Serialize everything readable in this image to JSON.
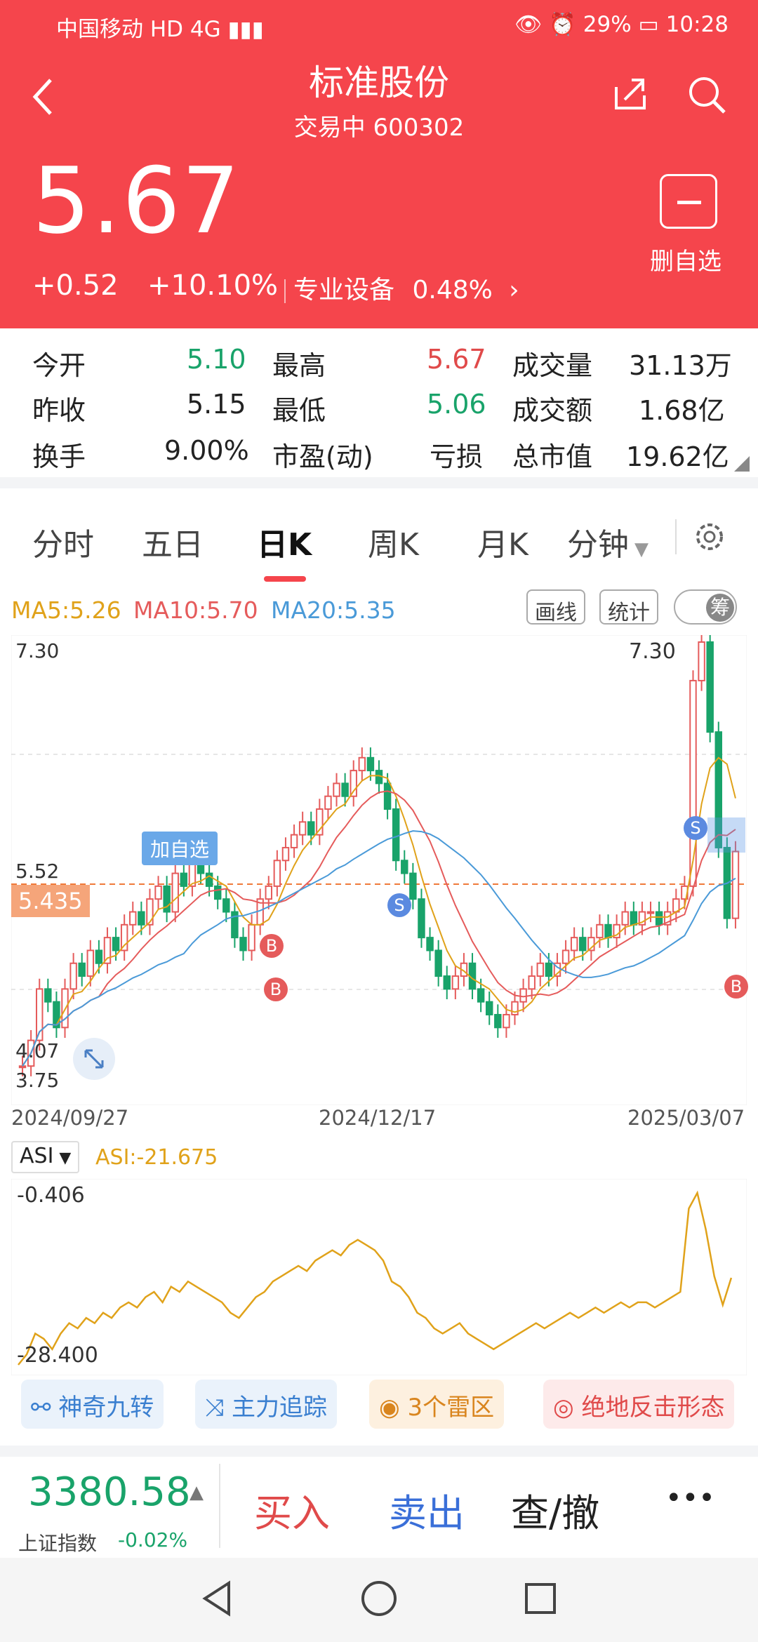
{
  "status_bar": {
    "left": "中国移动 HD 4G ▮▮▮",
    "right": "👁 ⏰ 29% ▭ 10:28"
  },
  "header": {
    "back_icon": "back-chevron-icon",
    "title": "标准股份",
    "subtitle": "交易中 600302",
    "share_icon": "share-icon",
    "search_icon": "search-icon"
  },
  "quote": {
    "price": "5.67",
    "change": "+0.52",
    "change_pct": "+10.10%",
    "sector": "专业设备",
    "sector_pct": "0.48%",
    "sector_arrow": "›",
    "remove_fav_label": "删自选"
  },
  "stats": {
    "row1": [
      {
        "label": "今开",
        "value": "5.10"
      },
      {
        "label": "最高",
        "value": "5.67"
      },
      {
        "label": "成交量",
        "value": "31.13万"
      }
    ],
    "row2": [
      {
        "label": "昨收",
        "value": "5.15"
      },
      {
        "label": "最低",
        "value": "5.06"
      },
      {
        "label": "成交额",
        "value": "1.68亿"
      }
    ],
    "row3": [
      {
        "label": "换手",
        "value": "9.00%"
      },
      {
        "label": "市盈(动)",
        "value": "亏损"
      },
      {
        "label": "总市值",
        "value": "19.62亿"
      }
    ]
  },
  "tabs": [
    "分时",
    "五日",
    "日K",
    "周K",
    "月K",
    "分钟"
  ],
  "tab_active": "日K",
  "ma": {
    "ma5": "MA5:5.26",
    "ma10": "MA10:5.70",
    "ma20": "MA20:5.35"
  },
  "chart_buttons": {
    "draw": "画线",
    "stats": "统计",
    "chip": "筹"
  },
  "chart_labels": {
    "y_high": "7.30",
    "y_low": "3.75",
    "peak": "7.30",
    "mid": "5.52",
    "cross": "5.435",
    "low_mark": "4.07",
    "add_fav_tag": "加自选"
  },
  "markers": {
    "buy": "B",
    "sell": "S"
  },
  "dates": [
    "2024/09/27",
    "2024/12/17",
    "2025/03/07"
  ],
  "asi": {
    "selector": "ASI",
    "value": "ASI:-21.675",
    "top": "-0.406",
    "bottom": "-28.400"
  },
  "features": [
    "神奇九转",
    "主力追踪",
    "3个雷区",
    "绝地反击形态"
  ],
  "bottom": {
    "index_value": "3380.58",
    "index_name": "上证指数",
    "index_pct": "-0.02%",
    "buy": "买入",
    "sell": "卖出",
    "query": "查/撤",
    "more": "•••"
  },
  "colors": {
    "red": "#f5454c",
    "green": "#19a36a",
    "ma5": "#e0a21a",
    "ma10": "#e55b5b",
    "ma20": "#4a9ad8"
  },
  "chart_data": {
    "type": "candlestick",
    "x_labels": [
      "2024/09/27",
      "2024/12/17",
      "2025/03/07"
    ],
    "ylim": [
      3.75,
      7.3
    ],
    "closes": [
      4.0,
      4.2,
      4.6,
      4.5,
      4.3,
      4.6,
      4.8,
      4.7,
      4.9,
      4.8,
      5.0,
      4.9,
      5.1,
      5.2,
      5.1,
      5.3,
      5.4,
      5.2,
      5.5,
      5.4,
      5.6,
      5.5,
      5.4,
      5.3,
      5.2,
      5.0,
      4.9,
      5.1,
      5.3,
      5.4,
      5.6,
      5.7,
      5.8,
      5.9,
      5.8,
      6.0,
      6.1,
      6.2,
      6.1,
      6.3,
      6.4,
      6.3,
      6.2,
      6.0,
      5.6,
      5.5,
      5.3,
      5.0,
      4.9,
      4.7,
      4.6,
      4.7,
      4.8,
      4.6,
      4.5,
      4.4,
      4.3,
      4.4,
      4.5,
      4.6,
      4.7,
      4.8,
      4.7,
      4.8,
      4.9,
      5.0,
      4.9,
      5.0,
      5.1,
      5.0,
      5.1,
      5.2,
      5.1,
      5.2,
      5.2,
      5.1,
      5.2,
      5.3,
      5.4,
      7.0,
      7.3,
      6.6,
      5.7,
      5.15,
      5.67
    ],
    "ma5_label": "5.26",
    "ma10_label": "5.70",
    "ma20_label": "5.35"
  }
}
